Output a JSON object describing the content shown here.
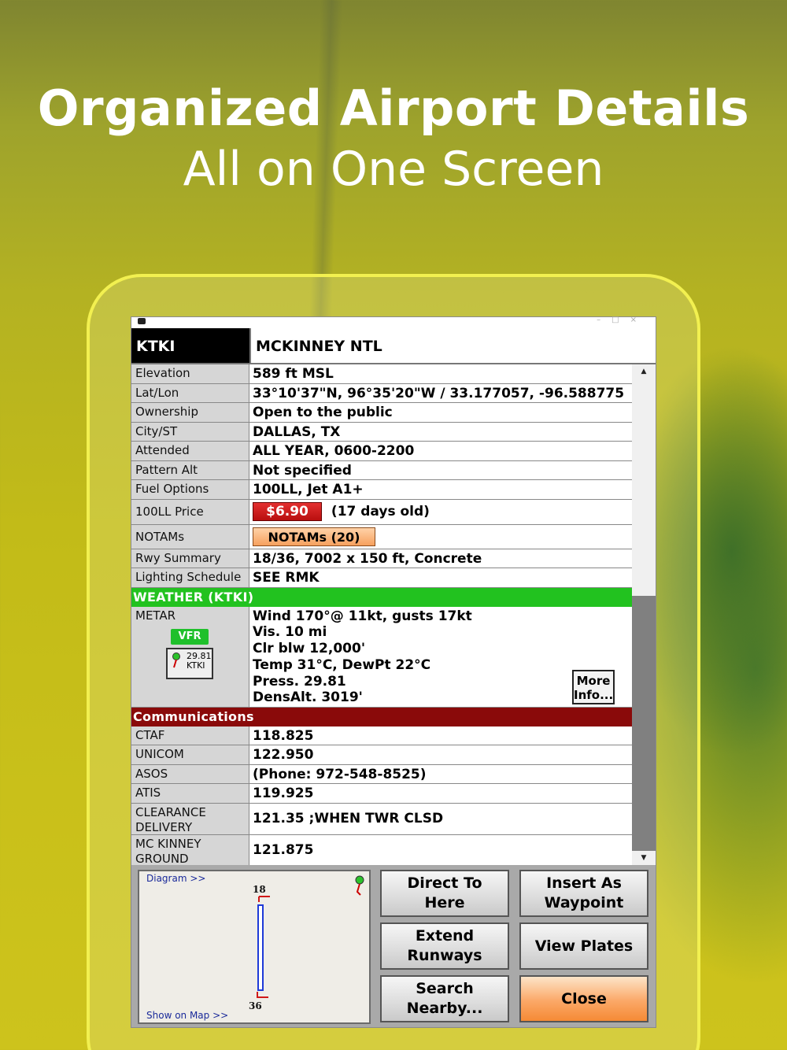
{
  "hero": {
    "title": "Organized Airport Details",
    "subtitle": "All on One Screen"
  },
  "airport": {
    "code": "KTKI",
    "name": "MCKINNEY NTL"
  },
  "details": [
    {
      "label": "Elevation",
      "value": "589 ft MSL"
    },
    {
      "label": "Lat/Lon",
      "value": "33°10'37\"N, 96°35'20\"W  /  33.177057, -96.588775"
    },
    {
      "label": "Ownership",
      "value": "Open to the public"
    },
    {
      "label": "City/ST",
      "value": "DALLAS, TX"
    },
    {
      "label": "Attended",
      "value": "ALL YEAR, 0600-2200"
    },
    {
      "label": "Pattern Alt",
      "value": "Not specified"
    },
    {
      "label": "Fuel Options",
      "value": "100LL, Jet A1+"
    }
  ],
  "price": {
    "label": "100LL Price",
    "value": "$6.90",
    "age": "(17 days old)"
  },
  "notams": {
    "label": "NOTAMs",
    "button": "NOTAMs (20)"
  },
  "details2": [
    {
      "label": "Rwy Summary",
      "value": "18/36, 7002 x 150 ft, Concrete"
    },
    {
      "label": "Lighting Schedule",
      "value": "SEE RMK"
    }
  ],
  "weather": {
    "header": "WEATHER  (KTKI)",
    "label": "METAR",
    "category": "VFR",
    "station_pressure": "29.81",
    "station_id": "KTKI",
    "lines": [
      "Wind 170°@ 11kt, gusts 17kt",
      "Vis. 10 mi",
      "Clr blw 12,000'",
      "Temp 31°C, DewPt 22°C",
      "Press. 29.81",
      "DensAlt. 3019'"
    ],
    "more_button": "More Info...",
    "more_line1": "More",
    "more_line2": "Info..."
  },
  "comms": {
    "header": "Communications",
    "items": [
      {
        "label": "CTAF",
        "value": "118.825"
      },
      {
        "label": "UNICOM",
        "value": "122.950"
      },
      {
        "label": "ASOS",
        "value": "(Phone: 972-548-8525)"
      },
      {
        "label": "ATIS",
        "value": "119.925"
      },
      {
        "label": "CLEARANCE DELIVERY",
        "value": "121.35 ;WHEN TWR CLSD"
      },
      {
        "label": "MC KINNEY GROUND",
        "value": "121.875"
      }
    ]
  },
  "diagram": {
    "diagram_link": "Diagram >>",
    "map_link": "Show on Map >>",
    "runway_top": "18",
    "runway_bottom": "36"
  },
  "buttons": {
    "direct_to": "Direct To Here",
    "insert_waypoint": "Insert As Waypoint",
    "extend_runways": "Extend Runways",
    "view_plates": "View Plates",
    "search_nearby": "Search Nearby...",
    "close": "Close"
  },
  "colors": {
    "weather_header": "#22c21f",
    "comms_header": "#8a0a0a",
    "price_badge": "#d01818",
    "notam_badge": "#f6a05e",
    "vfr_badge": "#1fc02b",
    "close_button": "#f58a35",
    "device_outline": "#f2f050"
  }
}
